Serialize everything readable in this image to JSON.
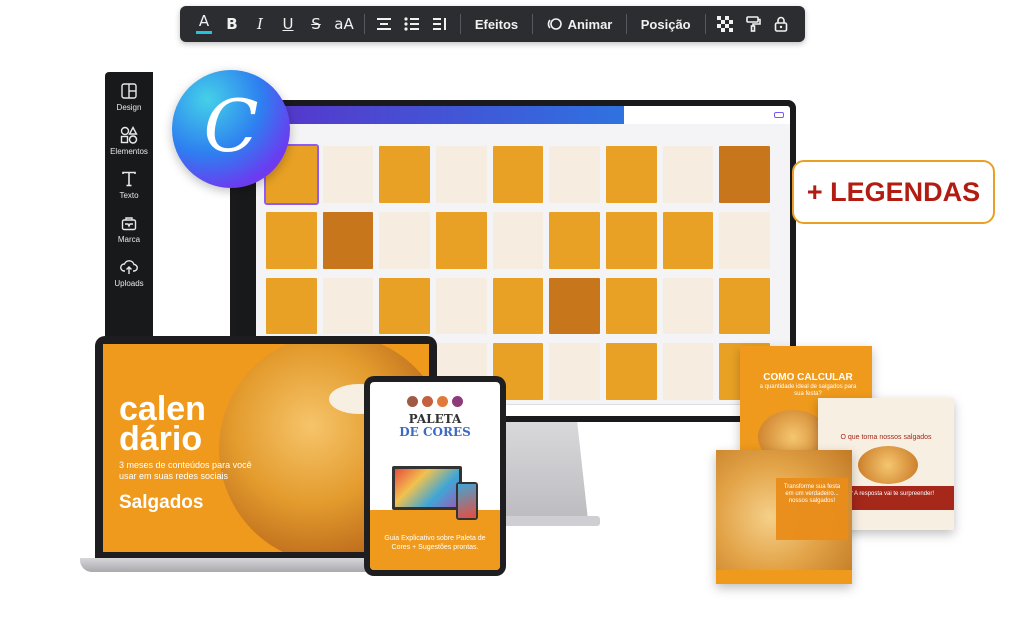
{
  "toolbar": {
    "font_color": "A",
    "bold": "B",
    "italic": "I",
    "underline": "U",
    "strike": "S",
    "case": "aA",
    "effects": "Efeitos",
    "animate": "Animar",
    "position": "Posição"
  },
  "sidebar": {
    "items": [
      {
        "label": "Design",
        "icon": "layout-icon"
      },
      {
        "label": "Elementos",
        "icon": "shapes-icon"
      },
      {
        "label": "Texto",
        "icon": "text-icon"
      },
      {
        "label": "Marca",
        "icon": "brand-icon"
      },
      {
        "label": "Uploads",
        "icon": "upload-icon"
      }
    ]
  },
  "canva_logo": "C",
  "legendas": "+ LEGENDAS",
  "laptop": {
    "title": "calen\ndário",
    "subtitle": "3 meses de conteúdos para você usar em suas redes sociais",
    "brand": "Salgados"
  },
  "tablet": {
    "title1": "PALETA",
    "title2": "DE CORES",
    "caption": "Guia Explicativo sobre Paleta de Cores + Sugestões prontas.",
    "dot_colors": [
      "#9e5a45",
      "#c4613e",
      "#e07a3a",
      "#8e3a7a"
    ]
  },
  "posts": {
    "post1_title": "COMO CALCULAR",
    "post1_sub": "a quantidade ideal de salgados para sua festa?",
    "post2_title": "O que torna nossos salgados",
    "post2_red": "viciantes? A resposta vai te surpreender!",
    "post3_text": "Transforme sua festa em um verdadeiro... nossos salgados!"
  },
  "colors": {
    "accent_orange": "#ef9a1c",
    "legendas_red": "#b11d12",
    "toolbar_bg": "#2b2d31"
  }
}
